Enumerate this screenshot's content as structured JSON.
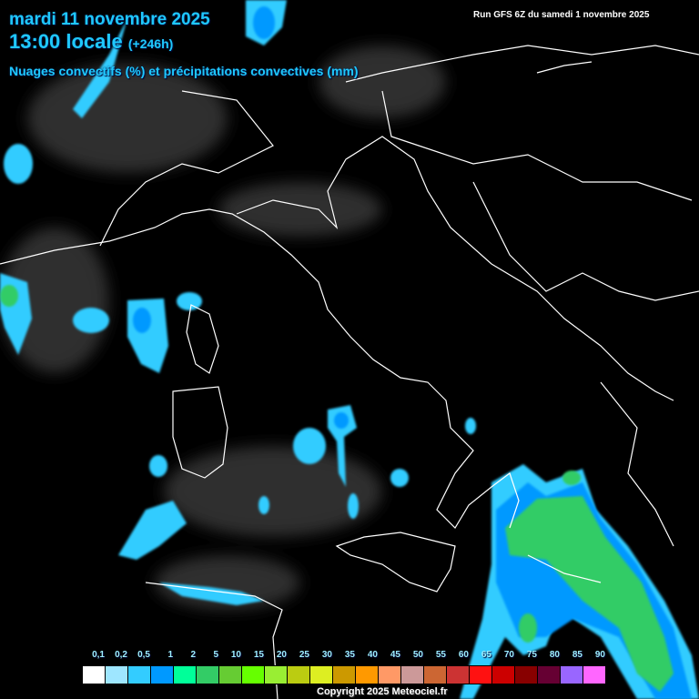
{
  "header": {
    "date": "mardi 11 novembre 2025",
    "time": "13:00 locale",
    "lead": "(+246h)",
    "product": "Nuages convectifs (%) et précipitations convectives (mm)",
    "run": "Run GFS 6Z du samedi 1 novembre 2025"
  },
  "legend": {
    "labels": [
      "0,1",
      "0,2",
      "0,5",
      "1",
      "2",
      "5",
      "10",
      "15",
      "20",
      "25",
      "30",
      "35",
      "40",
      "45",
      "50",
      "55",
      "60",
      "65",
      "70",
      "75",
      "80",
      "85",
      "90"
    ],
    "colors": [
      "#ffffff",
      "#9ee6ff",
      "#33ccff",
      "#0099ff",
      "#00ff99",
      "#33cc66",
      "#66cc33",
      "#66ff00",
      "#99ee33",
      "#bbcc11",
      "#ddee22",
      "#cc9900",
      "#ff9900",
      "#ff9966",
      "#cc9999",
      "#cc6633",
      "#cc3333",
      "#ff1111",
      "#cc0000",
      "#880000",
      "#660033",
      "#9966ff",
      "#ff66ff"
    ]
  },
  "footer": {
    "copyright": "Copyright 2025 Meteociel.fr"
  }
}
